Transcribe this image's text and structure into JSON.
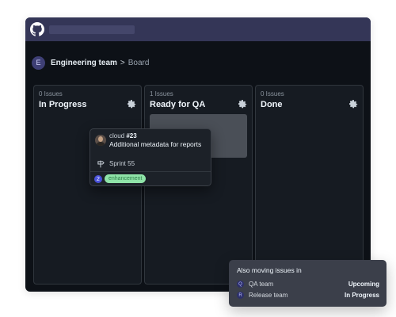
{
  "window": {
    "logo_icon": "github-icon"
  },
  "breadcrumb": {
    "avatar_letter": "E",
    "team": "Engineering team",
    "separator": ">",
    "page": "Board"
  },
  "columns": [
    {
      "count": "0 Issues",
      "title": "In Progress",
      "icon": "gear-icon"
    },
    {
      "count": "1 Issues",
      "title": "Ready for QA",
      "icon": "gear-icon"
    },
    {
      "count": "0 Issues",
      "title": "Done",
      "icon": "gear-icon"
    }
  ],
  "card": {
    "repo": "cloud",
    "number": "#23",
    "title": "Additional metadata for reports",
    "milestone_icon": "milestone-signpost-icon",
    "milestone": "Sprint 55",
    "count": "2",
    "label": "enhancement",
    "label_color": "#8fe3a8"
  },
  "popover": {
    "title": "Also moving issues in",
    "rows": [
      {
        "badge": "Q",
        "team": "QA team",
        "status": "Upcoming"
      },
      {
        "badge": "R",
        "team": "Release team",
        "status": "In Progress"
      }
    ]
  },
  "colors": {
    "titlebar": "#343657",
    "canvas": "#0d1117",
    "column": "#161b22",
    "accent": "#4a52d9"
  }
}
